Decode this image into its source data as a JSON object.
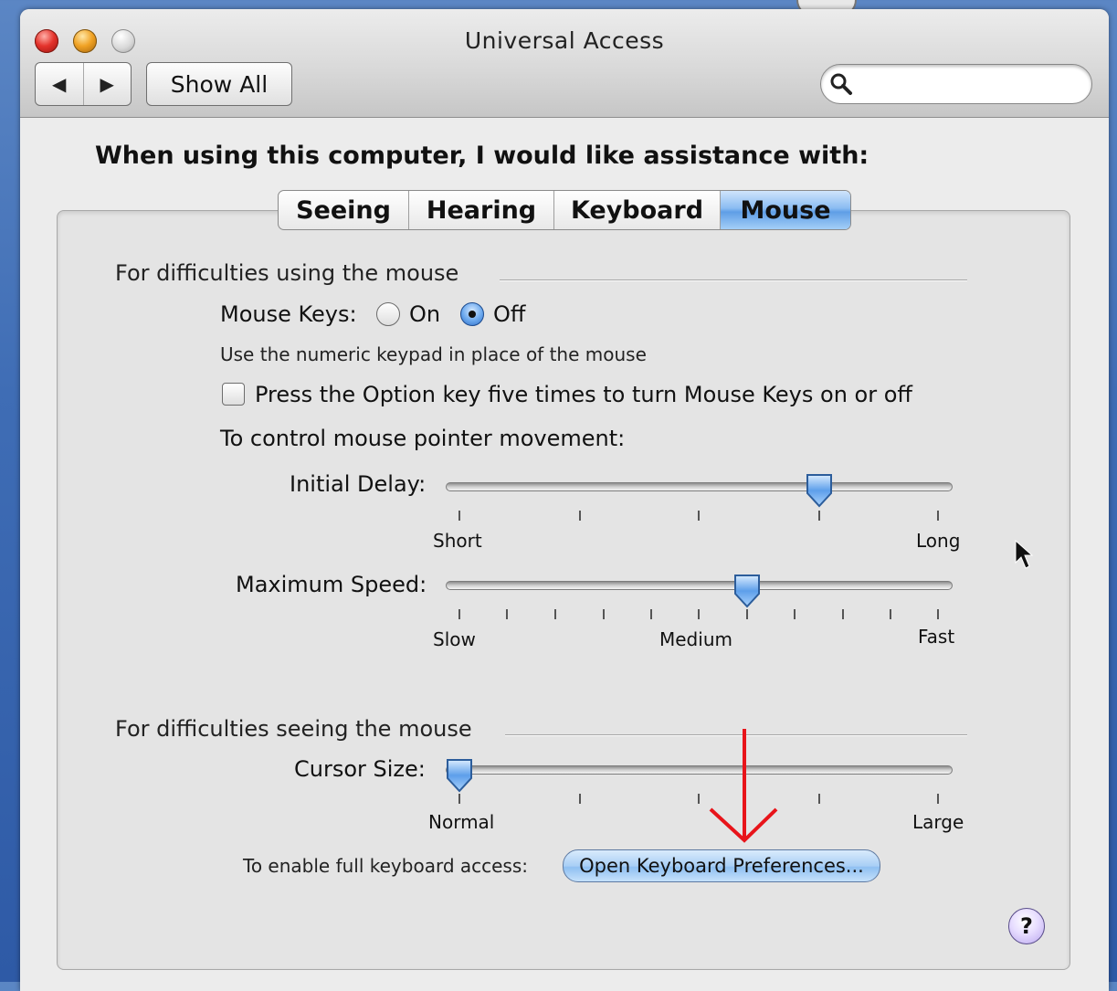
{
  "window": {
    "title": "Universal Access",
    "nav_back_glyph": "◀",
    "nav_forward_glyph": "▶",
    "show_all_label": "Show All",
    "search": {
      "placeholder": "",
      "value": ""
    }
  },
  "heading": "When using this computer, I would like assistance with:",
  "tabs": [
    {
      "label": "Seeing",
      "selected": false
    },
    {
      "label": "Hearing",
      "selected": false
    },
    {
      "label": "Keyboard",
      "selected": false
    },
    {
      "label": "Mouse",
      "selected": true
    }
  ],
  "mouse_section": {
    "title": "For difficulties using the mouse",
    "mouse_keys_label": "Mouse Keys:",
    "radio_on_label": "On",
    "radio_off_label": "Off",
    "selected": "Off",
    "keypad_hint": "Use the numeric keypad in place of the mouse",
    "option_checkbox_label": "Press the Option key five times to turn Mouse Keys on or off",
    "option_checkbox_checked": false,
    "pointer_movement_label": "To control mouse pointer movement:",
    "initial_delay": {
      "label": "Initial Delay:",
      "min_label": "Short",
      "max_label": "Long",
      "value": 0.75
    },
    "maximum_speed": {
      "label": "Maximum Speed:",
      "min_label": "Slow",
      "mid_label": "Medium",
      "max_label": "Fast",
      "value": 0.6
    }
  },
  "seeing_section": {
    "title": "For difficulties seeing the mouse",
    "cursor_size": {
      "label": "Cursor Size:",
      "min_label": "Normal",
      "max_label": "Large",
      "value": 0.0
    }
  },
  "keyboard_access": {
    "label": "To enable full keyboard access:",
    "button_label": "Open Keyboard Preferences..."
  },
  "help_label": "?",
  "colors": {
    "selected_tab": "#7fb4ef",
    "annotation_arrow": "#e8141a",
    "desktop": "#3f6db5"
  },
  "icons": {
    "search": "magnifier-icon",
    "help": "question-icon",
    "pointer": "mouse-pointer-icon"
  }
}
